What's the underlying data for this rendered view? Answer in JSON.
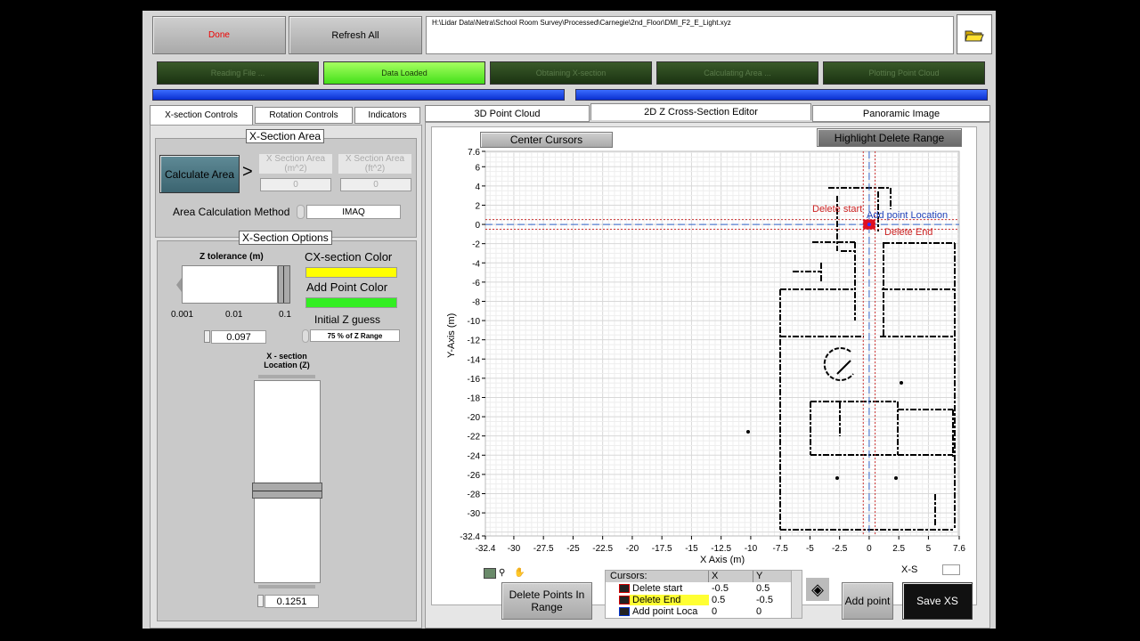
{
  "toolbar": {
    "done": "Done",
    "refresh": "Refresh All",
    "file_path": "H:\\Lidar Data\\Netra\\School Room Survey\\Processed\\Carnegie\\2nd_Floor\\DMI_F2_E_Light.xyz",
    "folder_icon": "folder-open-icon"
  },
  "status": [
    {
      "label": "Reading File ...",
      "on": false
    },
    {
      "label": "Data Loaded",
      "on": true
    },
    {
      "label": "Obtaining X-section",
      "on": false
    },
    {
      "label": "Calculating Area ...",
      "on": false
    },
    {
      "label": "Plotting Point Cloud",
      "on": false
    }
  ],
  "progress": {
    "left": 1.0,
    "right": 1.0
  },
  "left_tabs": [
    "X-section Controls",
    "Rotation Controls",
    "Indicators"
  ],
  "main_tabs": [
    "3D Point Cloud",
    "2D Z Cross-Section Editor",
    "Panoramic Image"
  ],
  "area": {
    "title": "X-Section Area",
    "calc_button": "Calculate Area",
    "arrow": ">",
    "m2_label": "X Section Area (m^2)",
    "m2_value": "0",
    "ft2_label": "X Section Area (ft^2)",
    "ft2_value": "0",
    "method_label": "Area Calculation Method",
    "method_value": "IMAQ"
  },
  "options": {
    "title": "X-Section Options",
    "ztol_label": "Z tolerance (m)",
    "ztol_ticks": [
      "0.001",
      "0.01",
      "0.1"
    ],
    "ztol_value": "0.097",
    "cx_color_label": "CX-section Color",
    "cx_color": "#ffff00",
    "add_color_label": "Add Point Color",
    "add_color": "#33ee22",
    "init_z_label": "Initial Z guess",
    "init_z_value": "75 % of  Z Range",
    "loc_label": "X - section Location (Z)",
    "loc_value": "0.1251",
    "loc_fraction": 0.5
  },
  "plot": {
    "center_cursors": "Center Cursors",
    "highlight": "Highlight Delete Range",
    "xlabel": "X Axis (m)",
    "ylabel": "Y-Axis (m)",
    "xticks": [
      "-32.4",
      "-30",
      "-27.5",
      "-25",
      "-22.5",
      "-20",
      "-17.5",
      "-15",
      "-12.5",
      "-10",
      "-7.5",
      "-5",
      "-2.5",
      "0",
      "2.5",
      "5",
      "7.6"
    ],
    "yticks": [
      "7.6",
      "6",
      "4",
      "2",
      "0",
      "-2",
      "-4",
      "-6",
      "-8",
      "-10",
      "-12",
      "-14",
      "-16",
      "-18",
      "-20",
      "-22",
      "-24",
      "-26",
      "-28",
      "-30",
      "-32.4"
    ],
    "xrange": [
      -32.4,
      7.6
    ],
    "yrange": [
      -32.4,
      7.6
    ],
    "cursor_labels": {
      "start": "Delete start",
      "end": "Delete End",
      "add": "Add point Location"
    }
  },
  "cursors": {
    "header": [
      "Cursors:",
      "X",
      "Y"
    ],
    "rows": [
      {
        "name": "Delete start",
        "x": "-0.5",
        "y": "0.5",
        "color": "#cc0000"
      },
      {
        "name": "Delete End",
        "x": "0.5",
        "y": "-0.5",
        "color": "#cc0000"
      },
      {
        "name": "Add point Loca",
        "x": "0",
        "y": "0",
        "color": "#0033cc"
      }
    ]
  },
  "bottom": {
    "delete_points": "Delete Points In Range",
    "add_point": "Add point",
    "save": "Save XS",
    "xs_label": "X-S"
  }
}
